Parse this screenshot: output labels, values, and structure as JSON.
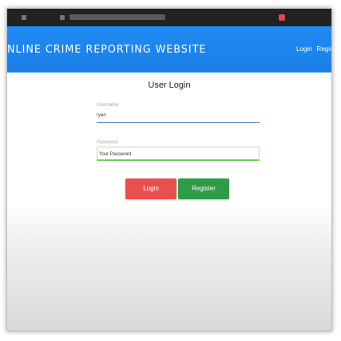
{
  "header": {
    "site_title": "NLINE CRIME REPORTING WEBSITE",
    "nav_login": "Login",
    "nav_register": "Regis"
  },
  "form": {
    "title": "User Login",
    "username_label": "Username",
    "username_value": "ryan",
    "password_label": "Password",
    "password_placeholder": "Your Password",
    "login_button": "Login",
    "register_button": "Register"
  },
  "colors": {
    "navbar": "#1e87f0",
    "login_button": "#e65050",
    "register_button": "#2f9a48"
  }
}
